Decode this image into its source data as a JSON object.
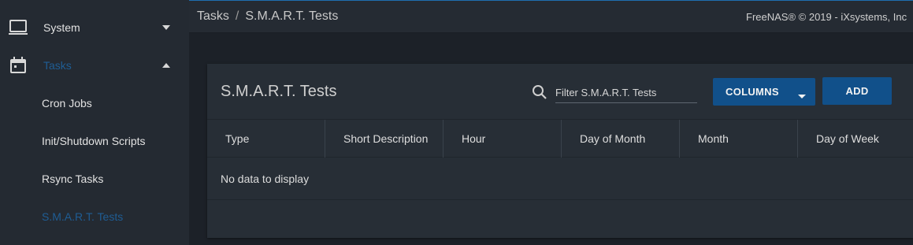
{
  "sidebar": {
    "items": [
      {
        "label": "System",
        "icon": "laptop-icon",
        "expanded": false
      },
      {
        "label": "Tasks",
        "icon": "calendar-icon",
        "expanded": true,
        "active": true
      },
      {
        "label": "Cron Jobs"
      },
      {
        "label": "Init/Shutdown Scripts"
      },
      {
        "label": "Rsync Tasks"
      },
      {
        "label": "S.M.A.R.T. Tests",
        "active": true
      }
    ]
  },
  "header": {
    "breadcrumb": [
      "Tasks",
      "S.M.A.R.T. Tests"
    ],
    "breadcrumb_sep": "/",
    "copyright": "FreeNAS® © 2019 - iXsystems, Inc"
  },
  "card": {
    "title": "S.M.A.R.T. Tests",
    "filter_placeholder": "Filter S.M.A.R.T. Tests",
    "filter_value": "",
    "columns_label": "COLUMNS",
    "add_label": "ADD"
  },
  "table": {
    "columns": [
      "Type",
      "Short Description",
      "Hour",
      "Day of Month",
      "Month",
      "Day of Week"
    ],
    "empty_message": "No data to display"
  },
  "colors": {
    "accent": "#11508a",
    "active_text": "#1f5d94",
    "sidebar_bg": "#242a32",
    "page_bg": "#1c2128",
    "card_bg": "#272e36"
  }
}
